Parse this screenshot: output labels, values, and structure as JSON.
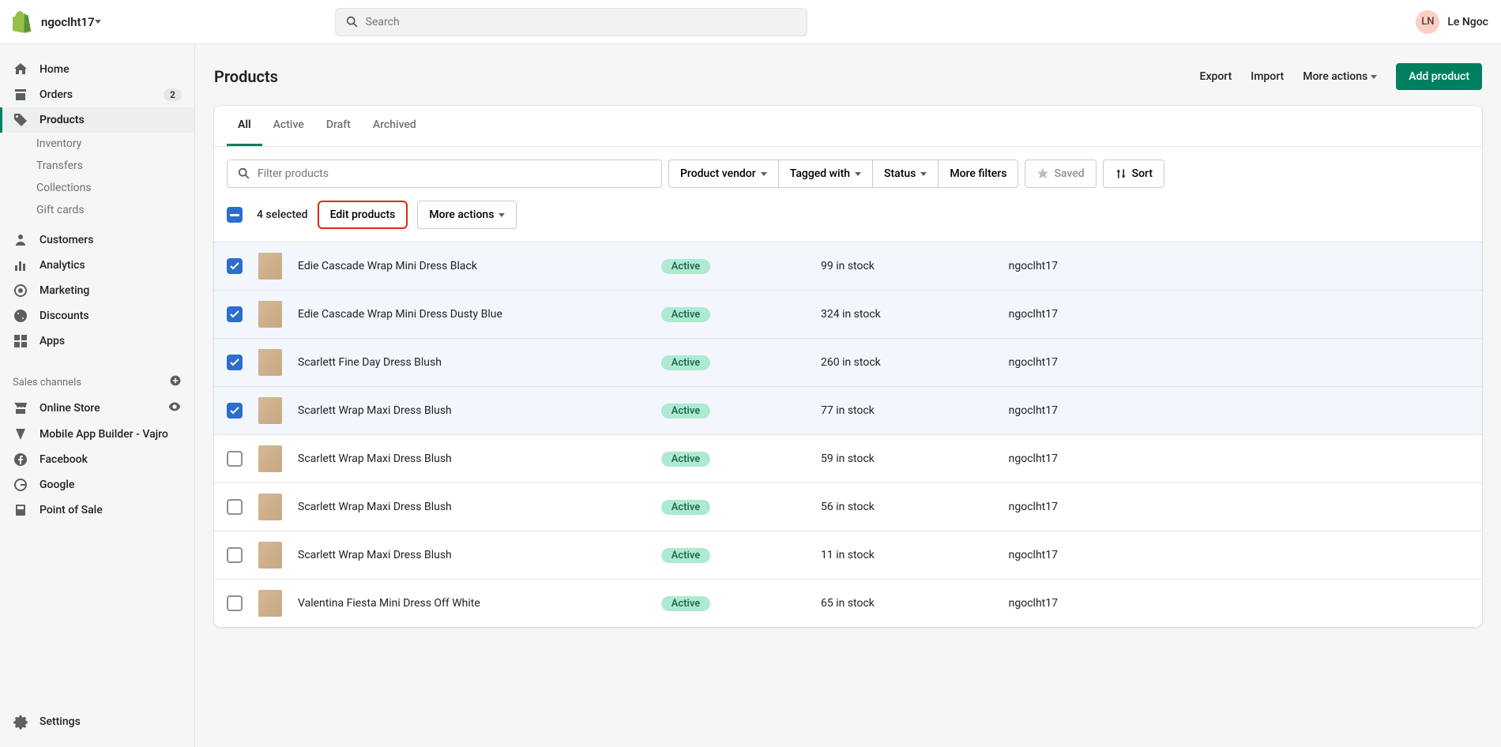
{
  "topbar": {
    "store_name": "ngoclht17",
    "search_placeholder": "Search",
    "user_initials": "LN",
    "user_name": "Le Ngoc"
  },
  "sidebar": {
    "items": [
      {
        "label": "Home"
      },
      {
        "label": "Orders",
        "badge": "2"
      },
      {
        "label": "Products"
      },
      {
        "label": "Customers"
      },
      {
        "label": "Analytics"
      },
      {
        "label": "Marketing"
      },
      {
        "label": "Discounts"
      },
      {
        "label": "Apps"
      }
    ],
    "products_sub": [
      {
        "label": "Inventory"
      },
      {
        "label": "Transfers"
      },
      {
        "label": "Collections"
      },
      {
        "label": "Gift cards"
      }
    ],
    "channels_title": "Sales channels",
    "channels": [
      {
        "label": "Online Store"
      },
      {
        "label": "Mobile App Builder - Vajro"
      },
      {
        "label": "Facebook"
      },
      {
        "label": "Google"
      },
      {
        "label": "Point of Sale"
      }
    ],
    "footer": {
      "label": "Settings"
    }
  },
  "page": {
    "title": "Products",
    "actions": {
      "export": "Export",
      "import": "Import",
      "more": "More actions",
      "add": "Add product"
    }
  },
  "tabs": [
    {
      "label": "All"
    },
    {
      "label": "Active"
    },
    {
      "label": "Draft"
    },
    {
      "label": "Archived"
    }
  ],
  "filters": {
    "placeholder": "Filter products",
    "vendor": "Product vendor",
    "tagged": "Tagged with",
    "status": "Status",
    "more": "More filters",
    "saved": "Saved",
    "sort": "Sort"
  },
  "bulk": {
    "count_label": "4 selected",
    "edit": "Edit products",
    "more": "More actions"
  },
  "products": [
    {
      "checked": true,
      "name": "Edie Cascade Wrap Mini Dress Black",
      "status": "Active",
      "inventory": "99 in stock",
      "vendor": "ngoclht17"
    },
    {
      "checked": true,
      "name": "Edie Cascade Wrap Mini Dress Dusty Blue",
      "status": "Active",
      "inventory": "324 in stock",
      "vendor": "ngoclht17"
    },
    {
      "checked": true,
      "name": "Scarlett Fine Day Dress Blush",
      "status": "Active",
      "inventory": "260 in stock",
      "vendor": "ngoclht17"
    },
    {
      "checked": true,
      "name": "Scarlett Wrap Maxi Dress Blush",
      "status": "Active",
      "inventory": "77 in stock",
      "vendor": "ngoclht17"
    },
    {
      "checked": false,
      "name": "Scarlett Wrap Maxi Dress Blush",
      "status": "Active",
      "inventory": "59 in stock",
      "vendor": "ngoclht17"
    },
    {
      "checked": false,
      "name": "Scarlett Wrap Maxi Dress Blush",
      "status": "Active",
      "inventory": "56 in stock",
      "vendor": "ngoclht17"
    },
    {
      "checked": false,
      "name": "Scarlett Wrap Maxi Dress Blush",
      "status": "Active",
      "inventory": "11 in stock",
      "vendor": "ngoclht17"
    },
    {
      "checked": false,
      "name": "Valentina Fiesta Mini Dress Off White",
      "status": "Active",
      "inventory": "65 in stock",
      "vendor": "ngoclht17"
    }
  ]
}
